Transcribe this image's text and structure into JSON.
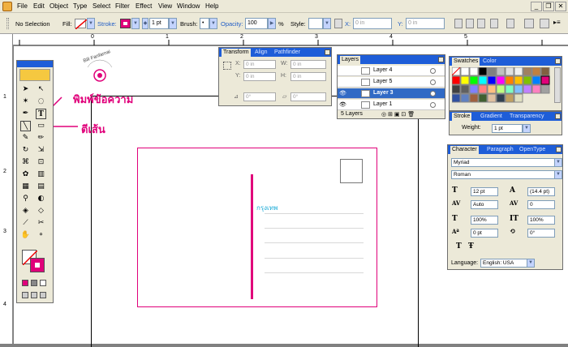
{
  "menu": [
    "File",
    "Edit",
    "Object",
    "Type",
    "Select",
    "Filter",
    "Effect",
    "View",
    "Window",
    "Help"
  ],
  "control_bar": {
    "selection": "No Selection",
    "fill_label": "Fill:",
    "stroke_label": "Stroke:",
    "stroke_weight": "1 pt",
    "brush_label": "Brush:",
    "opacity_label": "Opacity:",
    "opacity_value": "100",
    "opacity_unit": "%",
    "style_label": "Style:",
    "x_label": "X:",
    "x_value": "0 in",
    "y_label": "Y:",
    "y_value": "0 in"
  },
  "ruler": {
    "top": [
      "0",
      "1",
      "2",
      "3",
      "4",
      "5"
    ],
    "left": [
      "1",
      "2",
      "3",
      "4"
    ]
  },
  "canvas": {
    "address_text": "กรุงเทพ",
    "logo_text": "Bill Fanfarnai"
  },
  "annotations": {
    "type_tool_note": "พิมพ์ข้อความ",
    "line_tool_note": "ตีเส้น"
  },
  "transform_panel": {
    "tabs": [
      "Transform",
      "Align",
      "Pathfinder"
    ],
    "x_label": "X:",
    "x_value": "0 in",
    "y_label": "Y:",
    "y_value": "0 in",
    "w_label": "W:",
    "w_value": "0 in",
    "h_label": "H:",
    "h_value": "0 in",
    "angle_value": "0°",
    "shear_value": "0°"
  },
  "layers_panel": {
    "tab": "Layers",
    "layers": [
      "Layer 4",
      "Layer 5",
      "Layer 3",
      "Layer 1"
    ],
    "count": "5 Layers"
  },
  "swatches_panel": {
    "tabs": [
      "Swatches",
      "Color"
    ]
  },
  "stroke_panel": {
    "tabs": [
      "Stroke",
      "Gradient",
      "Transparency"
    ],
    "weight_label": "Weight:",
    "weight_value": "1 pt"
  },
  "character_panel": {
    "tabs": [
      "Character",
      "Paragraph",
      "OpenType"
    ],
    "font": "Myriad",
    "style": "Roman",
    "size": "12 pt",
    "leading": "(14.4 pt)",
    "kerning": "Auto",
    "tracking": "0",
    "h_scale": "100%",
    "v_scale": "100%",
    "baseline": "0 pt",
    "rotation": "0°",
    "language_label": "Language:",
    "language": "English: USA"
  }
}
